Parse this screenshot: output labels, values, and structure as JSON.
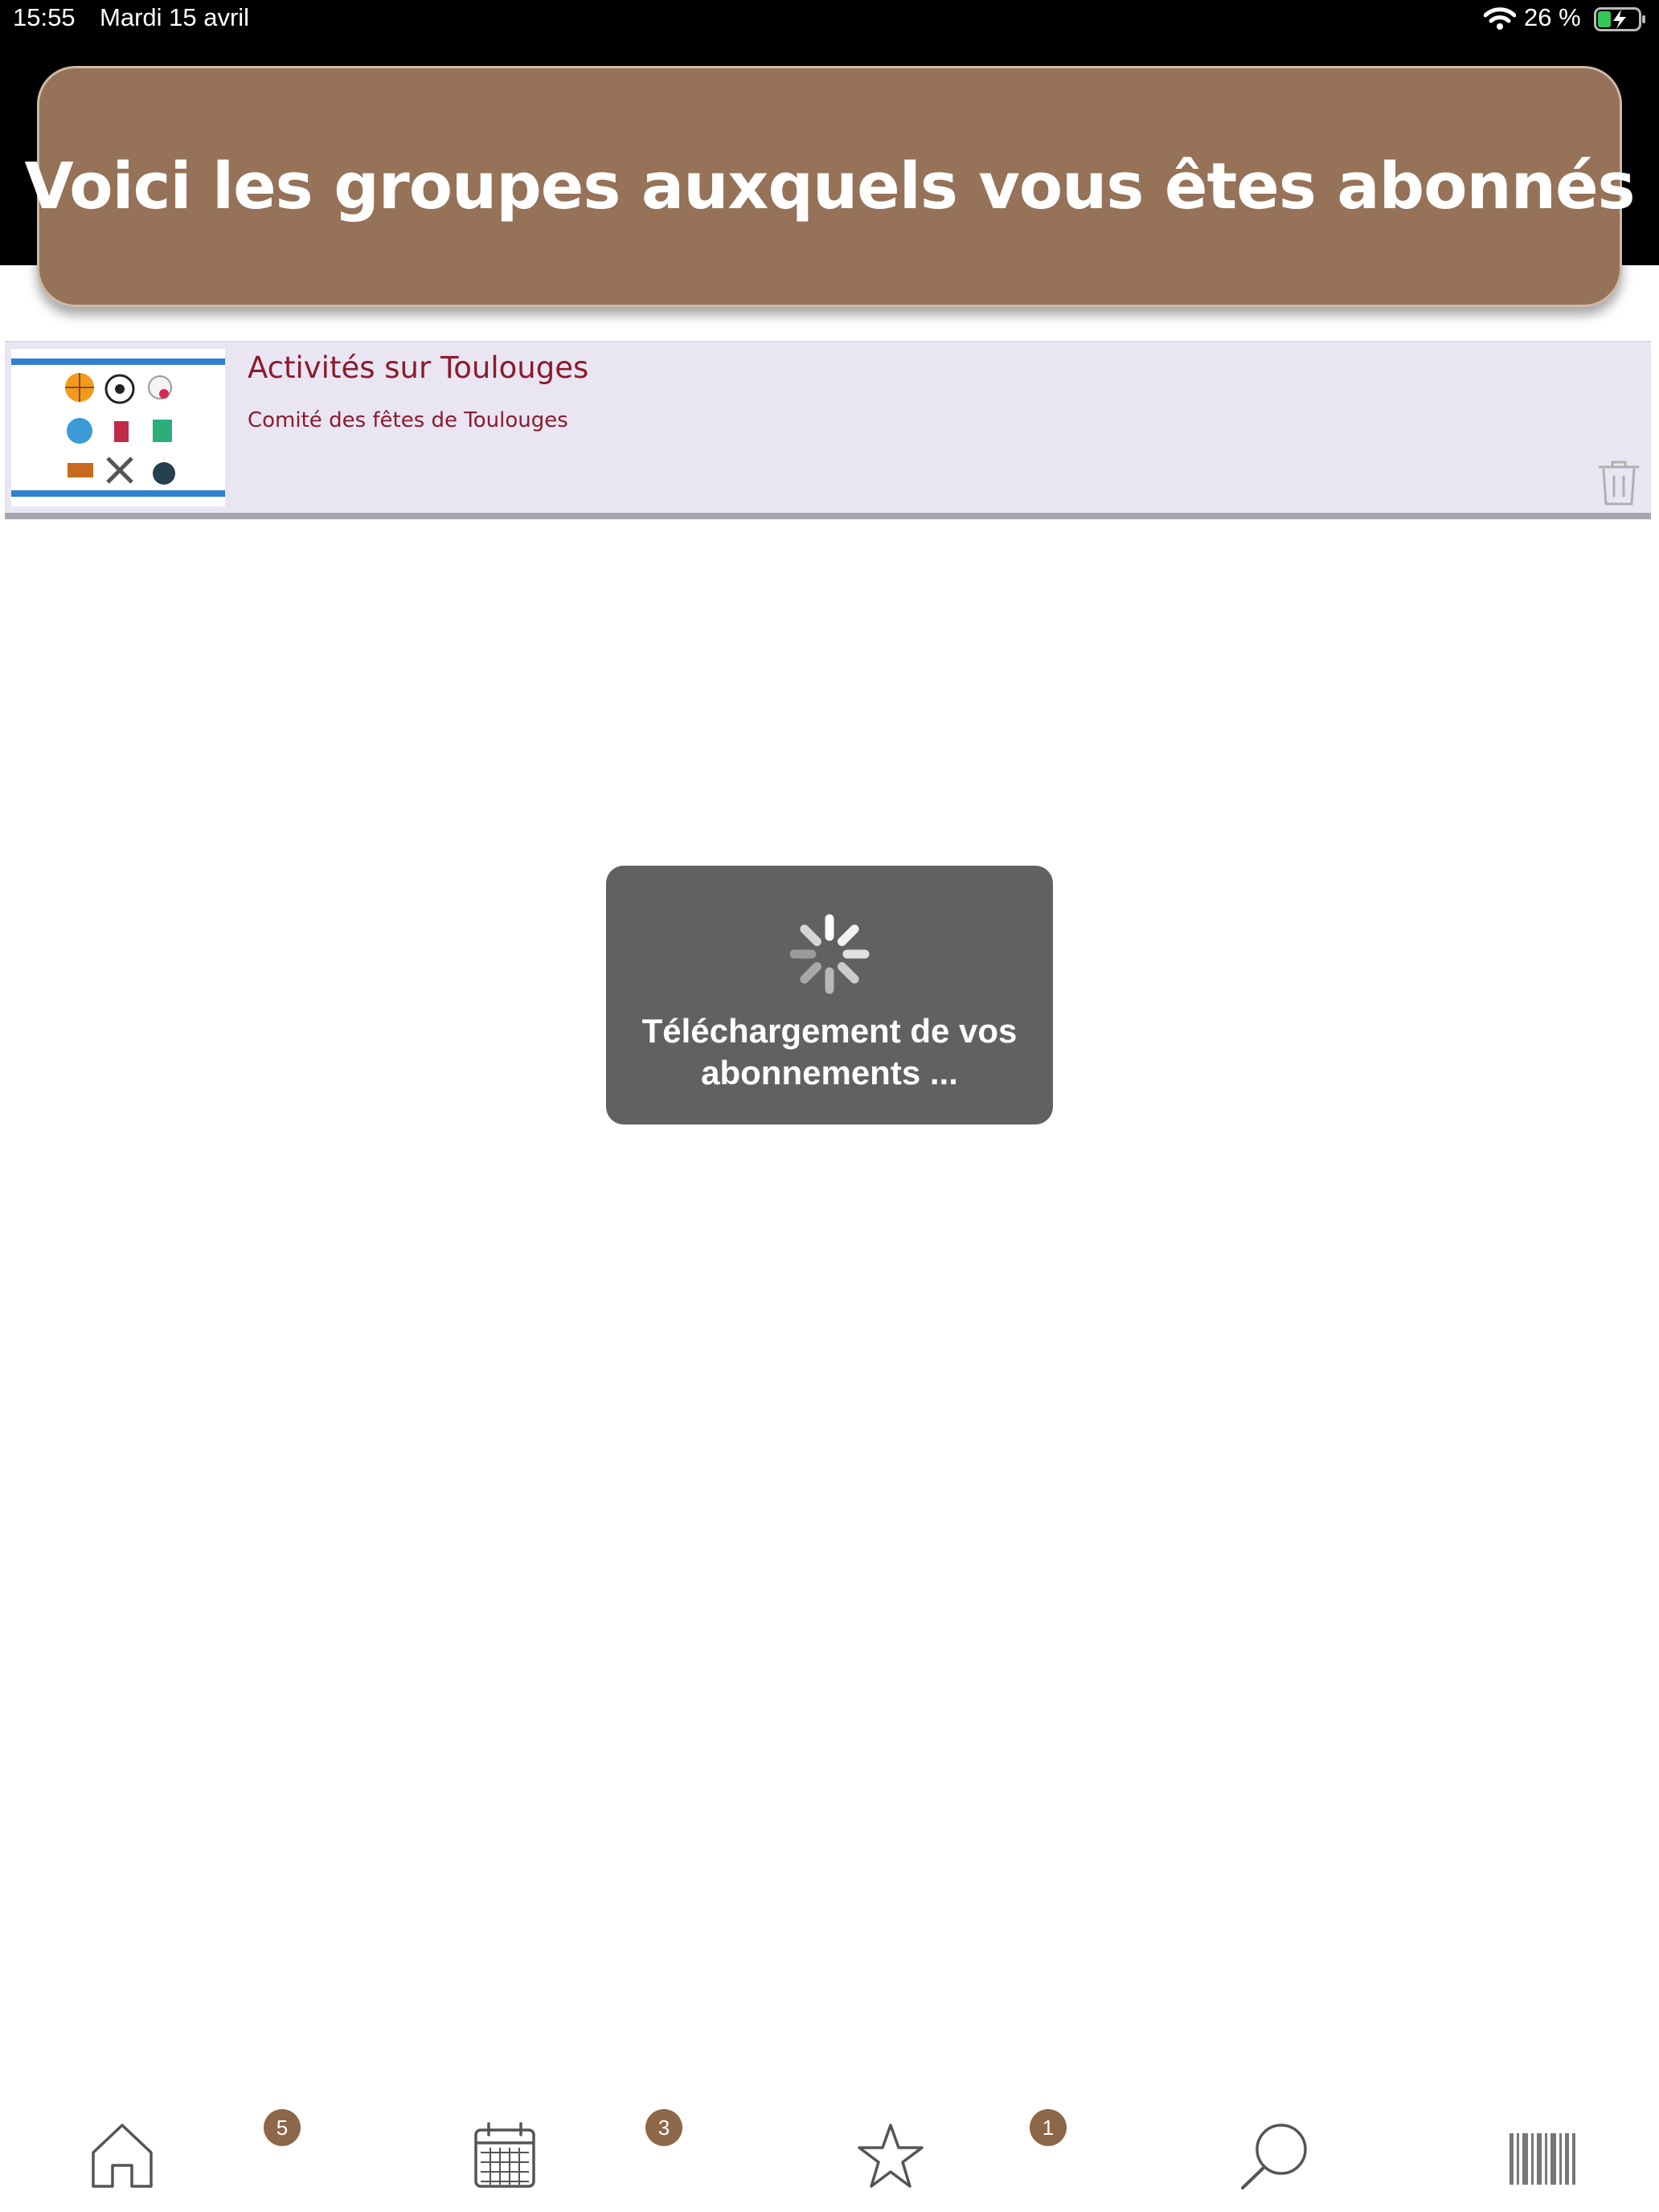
{
  "status_bar": {
    "time": "15:55",
    "date": "Mardi 15 avril",
    "battery": "26 %"
  },
  "header": {
    "title": "Voici les groupes auxquels vous êtes abonnés"
  },
  "groups": [
    {
      "title": "Activités sur Toulouges",
      "subtitle": "Comité des fêtes de Toulouges",
      "icon": "trash-icon"
    }
  ],
  "loading": {
    "line1": "Téléchargement de vos",
    "line2": "abonnements ..."
  },
  "tab_bar": {
    "tabs": [
      {
        "name": "home-icon",
        "badge": "5"
      },
      {
        "name": "calendar-icon",
        "badge": "3"
      },
      {
        "name": "star-icon",
        "badge": "1"
      },
      {
        "name": "search-icon"
      },
      {
        "name": "barcode-icon"
      }
    ]
  },
  "colors": {
    "banner": "#957258",
    "badge": "#8e6648",
    "row_background": "#e9e5f3",
    "row_text": "#8b1a2b",
    "hud": "#616161"
  }
}
